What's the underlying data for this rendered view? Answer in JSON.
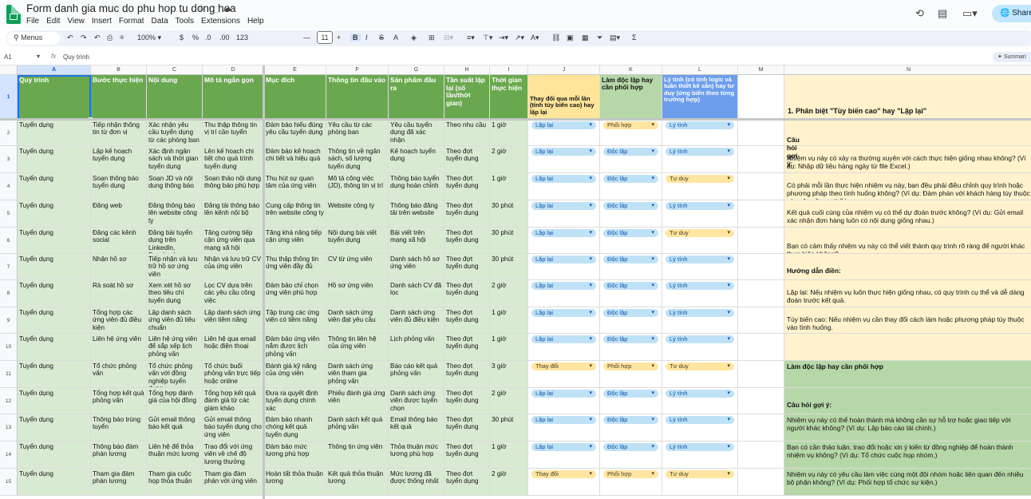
{
  "doc": {
    "title": "Form danh gia muc do phu hop tu dong hoa",
    "menu": [
      "File",
      "Edit",
      "View",
      "Insert",
      "Format",
      "Data",
      "Tools",
      "Extensions",
      "Help"
    ],
    "share": "Share"
  },
  "toolbar": {
    "menus": "Menus",
    "zoom": "100%",
    "currency": "$",
    "percent": "%",
    "dec_less": ".0",
    "dec_more": ".00",
    "format_123": "123",
    "font_size": "11",
    "font_family_placeholder": ""
  },
  "formula_bar": {
    "cell_ref": "A1",
    "fx": "fx",
    "value": "Quy trình",
    "summary": "Summari"
  },
  "columns": [
    "A",
    "B",
    "C",
    "D",
    "E",
    "F",
    "G",
    "H",
    "I",
    "J",
    "K",
    "L",
    "M",
    "N"
  ],
  "rows": [
    "1",
    "2",
    "3",
    "4",
    "5",
    "6",
    "7",
    "8",
    "9",
    "10",
    "11",
    "12",
    "13",
    "14",
    "15"
  ],
  "headers": {
    "A": "Quy trình",
    "B": "Bước thực hiện",
    "C": "Nội dung",
    "D": "Mô tả ngắn gọn",
    "E": "Mục đích",
    "F": "Thông tin đầu vào",
    "G": "Sản phẩm đầu ra",
    "H": "Tần suất lặp lại (số lần/thời gian)",
    "I": "Thời gian thực hiện",
    "J": "Thay đổi qua mỗi lần (tính tùy biến cao) hay lặp lại",
    "K": "Làm độc lập hay cần phối hợp",
    "L": "Lý tính (có tính logic và tuần thiết kế sẵn) hay tư duy (ứng biến theo từng trường hợp)",
    "N": "1. Phân biệt \"Tùy biến cao\" hay \"Lặp lại\""
  },
  "data_rows": [
    {
      "A": "Tuyển dụng",
      "B": "Tiếp nhận thông tin từ đơn vị",
      "C": "Xác nhận yêu cầu tuyển dụng từ các phòng ban",
      "D": "Thu thập thông tin vị trí cần tuyển",
      "E": "Đảm bảo hiểu đúng yêu cầu tuyển dụng",
      "F": "Yêu cầu từ các phòng ban",
      "G": "Yêu cầu tuyển dụng đã xác nhận",
      "H": "Theo nhu cầu",
      "I": "1 giờ",
      "J": "Lặp lại",
      "K": "Phối hợp",
      "L": "Lý tính",
      "N": ""
    },
    {
      "A": "Tuyển dụng",
      "B": "Lập kế hoạch tuyển dụng",
      "C": "Xác định ngân sách và thời gian tuyển dụng",
      "D": "Lên kế hoạch chi tiết cho quá trình tuyển dụng",
      "E": "Đảm bảo kế hoạch chi tiết và hiệu quả",
      "F": "Thông tin về ngân sách, số lượng tuyển dụng",
      "G": "Kế hoạch tuyển dụng",
      "H": "Theo đợt tuyển dụng",
      "I": "2 giờ",
      "J": "Lặp lại",
      "K": "Độc lập",
      "L": "Lý tính",
      "N": "Nhiệm vụ này có xảy ra thường xuyên với cách thực hiện giống nhau không? (Ví dụ: Nhập dữ liệu hàng ngày từ file Excel.)"
    },
    {
      "A": "Tuyển dụng",
      "B": "Soạn thông báo tuyển dụng",
      "C": "Soạn JD và nội dung thông báo",
      "D": "Soạn thảo nội dung thông báo phù hợp",
      "E": "Thu hút sự quan tâm của ứng viên",
      "F": "Mô tả công việc (JD), thông tin vị trí",
      "G": "Thông báo tuyển dụng hoàn chỉnh",
      "H": "Theo đợt tuyển dụng",
      "I": "1 giờ",
      "J": "Lặp lại",
      "K": "Độc lập",
      "L": "Tư duy",
      "N": "Có phải mỗi lần thực hiện nhiệm vụ này, bạn đều phải điều chỉnh quy trình hoặc phương pháp theo tình huống không? (Ví dụ: Đàm phán với khách hàng tùy thuộc vào yêu cầu cụ thể.)"
    },
    {
      "A": "Tuyển dụng",
      "B": "Đăng web",
      "C": "Đăng thông báo lên website công ty",
      "D": "Đăng tải thông báo lên kênh nội bộ",
      "E": "Cung cấp thông tin trên website công ty",
      "F": "Website công ty",
      "G": "Thông báo đăng tải trên website",
      "H": "Theo đợt tuyển dụng",
      "I": "30 phút",
      "J": "Lặp lại",
      "K": "Độc lập",
      "L": "Lý tính",
      "N": "Kết quả cuối cùng của nhiệm vụ có thể dự đoán trước không? (Ví dụ: Gửi email xác nhận đơn hàng luôn có nội dung giống nhau.)"
    },
    {
      "A": "Tuyển dụng",
      "B": "Đăng các kênh social",
      "C": "Đăng bài tuyển dụng trên LinkedIn, Facebook",
      "D": "Tăng cường tiếp cận ứng viên qua mạng xã hội",
      "E": "Tăng khả năng tiếp cận ứng viên",
      "F": "Nội dung bài viết tuyển dụng",
      "G": "Bài viết trên mạng xã hội",
      "H": "Theo đợt tuyển dụng",
      "I": "30 phút",
      "J": "Lặp lại",
      "K": "Độc lập",
      "L": "Tư duy",
      "N": "Bạn có cảm thấy nhiệm vụ này có thể viết thành quy trình rõ ràng để người khác thực hiện không?"
    },
    {
      "A": "Tuyển dụng",
      "B": "Nhận hồ sơ",
      "C": "Tiếp nhận và lưu trữ hồ sơ ứng viên",
      "D": "Nhận và lưu trữ CV của ứng viên",
      "E": "Thu thập thông tin ứng viên đầy đủ",
      "F": "CV từ ứng viên",
      "G": "Danh sách hồ sơ ứng viên",
      "H": "Theo đợt tuyển dụng",
      "I": "30 phút",
      "J": "Lặp lại",
      "K": "Độc lập",
      "L": "Lý tính",
      "N": "Hướng dẫn điền:"
    },
    {
      "A": "Tuyển dụng",
      "B": "Rà soát hồ sơ",
      "C": "Xem xét hồ sơ theo tiêu chí tuyển dụng",
      "D": "Lọc CV dựa trên các yêu cầu công việc",
      "E": "Đảm bảo chỉ chọn ứng viên phù hợp",
      "F": "Hồ sơ ứng viên",
      "G": "Danh sách CV đã lọc",
      "H": "Theo đợt tuyển dụng",
      "I": "2 giờ",
      "J": "Lặp lại",
      "K": "Độc lập",
      "L": "Lý tính",
      "N": "Lặp lại: Nếu nhiệm vụ luôn thực hiện giống nhau, có quy trình cụ thể và dễ dàng đoán trước kết quả."
    },
    {
      "A": "Tuyển dụng",
      "B": "Tổng hợp các ứng viên đủ điều kiện",
      "C": "Lập danh sách ứng viên đủ tiêu chuẩn",
      "D": "Lập danh sách ứng viên tiềm năng",
      "E": "Tập trung các ứng viên có tiềm năng",
      "F": "Danh sách ứng viên đạt yêu cầu",
      "G": "Danh sách ứng viên đủ điều kiện",
      "H": "Theo đợt tuyển dụng",
      "I": "1 giờ",
      "J": "Lặp lại",
      "K": "Độc lập",
      "L": "Lý tính",
      "N": "Tùy biến cao: Nếu nhiệm vụ cần thay đổi cách làm hoặc phương pháp tùy thuộc vào tình huống."
    },
    {
      "A": "Tuyển dụng",
      "B": "Liên hệ ứng viên",
      "C": "Liên hệ ứng viên để sắp xếp lịch phỏng vấn",
      "D": "Liên hệ qua email hoặc điện thoại",
      "E": "Đảm bảo ứng viên nắm được lịch phỏng vấn",
      "F": "Thông tin liên hệ của ứng viên",
      "G": "Lịch phỏng vấn",
      "H": "Theo đợt tuyển dụng",
      "I": "1 giờ",
      "J": "Lặp lại",
      "K": "Độc lập",
      "L": "Lý tính",
      "N": ""
    },
    {
      "A": "Tuyển dụng",
      "B": "Tổ chức phỏng vấn",
      "C": "Tổ chức phỏng vấn với đồng nghiệp tuyển dụng",
      "D": "Tổ chức buổi phỏng vấn trực tiếp hoặc online",
      "E": "Đánh giá kỹ năng của ứng viên",
      "F": "Danh sách ứng viên tham gia phỏng vấn",
      "G": "Báo cáo kết quả phỏng vấn",
      "H": "Theo đợt tuyển dụng",
      "I": "3 giờ",
      "J": "Thay đổi",
      "K": "Phối hợp",
      "L": "Tư duy",
      "N": "Làm độc lập hay cần phối hợp"
    },
    {
      "A": "Tuyển dụng",
      "B": "Tổng hợp kết quả phỏng vấn",
      "C": "Tổng hợp đánh giá của hội đồng",
      "D": "Tổng hợp kết quả đánh giá từ các giám khảo",
      "E": "Đưa ra quyết định tuyển dụng chính xác",
      "F": "Phiếu đánh giá ứng viên",
      "G": "Danh sách ứng viên được tuyển chọn",
      "H": "Theo đợt tuyển dụng",
      "I": "2 giờ",
      "J": "Lặp lại",
      "K": "Độc lập",
      "L": "Lý tính",
      "N": "Câu hỏi gợi ý:"
    },
    {
      "A": "Tuyển dụng",
      "B": "Thông báo trúng tuyển",
      "C": "Gửi email thông báo kết quả",
      "D": "Gửi email thông báo tuyển dụng cho ứng viên",
      "E": "Đảm bảo nhanh chóng kết quả tuyển dụng",
      "F": "Danh sách kết quả phỏng vấn",
      "G": "Email thông báo kết quả",
      "H": "Theo đợt tuyển dụng",
      "I": "30 phút",
      "J": "Lặp lại",
      "K": "Độc lập",
      "L": "Lý tính",
      "N": "Nhiệm vụ này có thể hoàn thành mà không cần sự hỗ trợ hoặc giao tiếp với người khác không? (Ví dụ: Lập báo cáo tài chính.)"
    },
    {
      "A": "Tuyển dụng",
      "B": "Thông báo đàm phán lương",
      "C": "Liên hệ để thỏa thuận mức lương",
      "D": "Trao đổi với ứng viên về chế độ lương thưởng",
      "E": "Đảm bảo mức lương phù hợp",
      "F": "Thông tin ứng viên",
      "G": "Thỏa thuận mức lương phù hợp",
      "H": "Theo đợt tuyển dụng",
      "I": "1 giờ",
      "J": "Lặp lại",
      "K": "Độc lập",
      "L": "Lý tính",
      "N": "Bạn có cần thảo luận, trao đổi hoặc xin ý kiến từ đồng nghiệp để hoàn thành nhiệm vụ không? (Ví dụ: Tổ chức cuộc họp nhóm.)"
    },
    {
      "A": "Tuyển dụng",
      "B": "Tham gia đàm phán lương",
      "C": "Tham gia cuộc họp thỏa thuận",
      "D": "Tham gia đàm phán với ứng viên",
      "E": "Hoàn tất thỏa thuận lương",
      "F": "Kết quả thỏa thuận lương",
      "G": "Mức lương đã được thống nhất",
      "H": "Theo đợt tuyển dụng",
      "I": "2 giờ",
      "J": "Thay đổi",
      "K": "Phối hợp",
      "L": "Tư duy",
      "N": "Nhiệm vụ này có yêu cầu làm việc cùng một đội nhóm hoặc liên quan đến nhiều bộ phận không? (Ví dụ: Phối hợp tổ chức sự kiện.)"
    }
  ],
  "n_extra": {
    "row2_right": "Câu hỏi gợi ý:"
  },
  "colors": {
    "header_green": "#6aa84f",
    "data_green": "#d9ead3",
    "header_yellow": "#ffe599",
    "header_lightgreen": "#b6d7a8",
    "header_blue": "#6d9eeb",
    "note_yellow": "#fff2cc",
    "note_green": "#b6d7a8",
    "chip_blue": "#bfe1f6",
    "chip_yellow": "#ffe5a0"
  }
}
